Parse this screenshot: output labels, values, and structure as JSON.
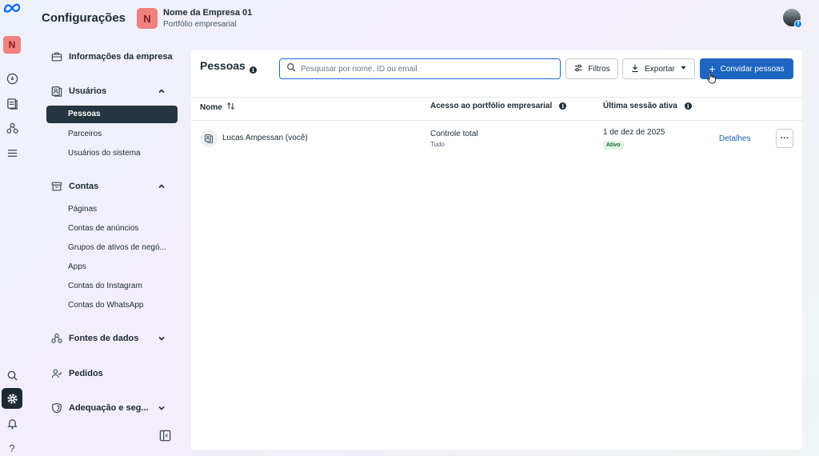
{
  "header": {
    "title": "Configurações",
    "business_initial": "N",
    "business_name": "Nome da Empresa 01",
    "business_subtitle": "Portfólio empresarial"
  },
  "rail": {
    "initial": "N",
    "icons": [
      "meta-logo-icon",
      "compass-icon",
      "pages-icon",
      "network-icon",
      "menu-icon",
      "search-icon",
      "gear-icon",
      "bell-icon",
      "help-icon"
    ]
  },
  "sidebar": {
    "company_info": "Informações da empresa",
    "users": {
      "label": "Usuários",
      "items": [
        "Pessoas",
        "Parceiros",
        "Usuários do sistema"
      ],
      "selected": "Pessoas"
    },
    "accounts": {
      "label": "Contas",
      "items": [
        "Páginas",
        "Contas de anúncios",
        "Grupos de ativos de negó...",
        "Apps",
        "Contas do Instagram",
        "Contas do WhatsApp"
      ]
    },
    "data_sources": "Fontes de dados",
    "orders": "Pedidos",
    "compliance": "Adequação e seg..."
  },
  "main": {
    "title": "Pessoas",
    "search_placeholder": "Pesquisar por nome, ID ou email",
    "filters_label": "Filtros",
    "export_label": "Exportar",
    "invite_label": "Convidar pessoas",
    "columns": {
      "name": "Nome",
      "access": "Acesso ao portfólio empresarial",
      "last_session": "Última sessão ativa"
    },
    "rows": [
      {
        "name": "Lucas Ampessan (você)",
        "access": "Controle total",
        "access_detail": "Tudo",
        "last_session": "1 de dez de 2025",
        "status": "Ativo",
        "details_link": "Detalhes"
      }
    ]
  },
  "colors": {
    "primary": "#1d65c1",
    "selected_nav": "#253641",
    "badge_red": "#f0817e",
    "status_green": "#1f6b34"
  }
}
